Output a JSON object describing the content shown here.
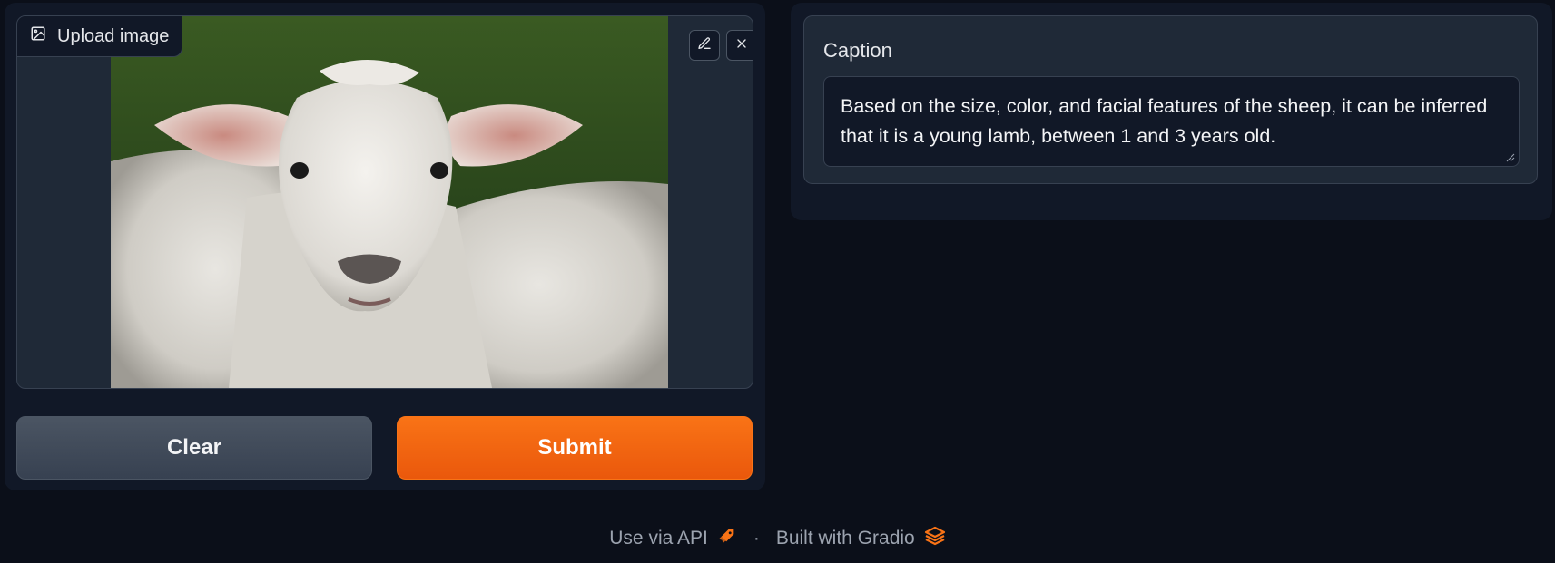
{
  "image_input": {
    "label": "Upload image",
    "edit_icon": "pencil-icon",
    "clear_icon": "close-icon",
    "image_subject": "lamb photo"
  },
  "buttons": {
    "clear_label": "Clear",
    "submit_label": "Submit"
  },
  "output": {
    "label": "Caption",
    "value": "Based on the size, color, and facial features of the sheep, it can be inferred that it is a young lamb, between 1 and 3 years old."
  },
  "footer": {
    "api_label": "Use via API",
    "separator": "·",
    "built_label": "Built with Gradio"
  },
  "colors": {
    "accent": "#f97316",
    "background": "#0b0f19",
    "panel": "#111827"
  }
}
